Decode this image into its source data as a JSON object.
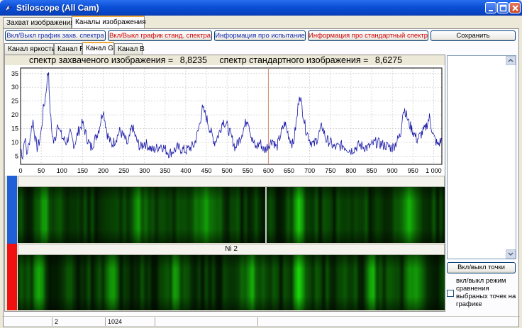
{
  "window": {
    "title": "Stiloscope (All Cam)"
  },
  "tabs": [
    "Захват изображения",
    "Каналы изображения"
  ],
  "toolbar": {
    "btn_captured": "Вкл/Выкл график захв. спектра",
    "btn_standard": "Вкл/Выкл график станд. спектра",
    "btn_test_info": "Информация про испытание",
    "btn_std_info": "Информация про стандартный спектр",
    "btn_save": "Сохранить"
  },
  "channel_tabs": [
    "Канал яркость",
    "Канал R",
    "Канал G",
    "Канал B"
  ],
  "chart_header": {
    "captured_label": "спектр захваченого изображения =",
    "captured_value": "8,8235",
    "standard_label": "спектр стандартного изображения =",
    "standard_value": "8,6275"
  },
  "chart_data": {
    "type": "line",
    "title": "",
    "xlabel": "",
    "ylabel": "",
    "xlim": [
      0,
      1020
    ],
    "ylim": [
      2,
      37
    ],
    "x_ticks": [
      0,
      50,
      100,
      150,
      200,
      250,
      300,
      350,
      400,
      450,
      500,
      550,
      600,
      650,
      700,
      750,
      800,
      850,
      900,
      950,
      1000
    ],
    "x_tick_labels": [
      "0",
      "50",
      "100",
      "150",
      "200",
      "250",
      "300",
      "350",
      "400",
      "450",
      "500",
      "550",
      "600",
      "650",
      "700",
      "750",
      "800",
      "850",
      "900",
      "950",
      "1 000"
    ],
    "y_ticks": [
      5,
      10,
      15,
      20,
      25,
      30,
      35
    ],
    "grid": true,
    "marker_x": 600,
    "colors": {
      "line": "#1a1aa8",
      "marker": "#d08a6a"
    },
    "series": [
      {
        "x": [
          0,
          5,
          10,
          15,
          20,
          25,
          30,
          35,
          40,
          45,
          50,
          55,
          60,
          65,
          68,
          70,
          75,
          80,
          85,
          90,
          95,
          100,
          110,
          120,
          130,
          140,
          150,
          160,
          170,
          180,
          190,
          200,
          210,
          220,
          230,
          240,
          250,
          260,
          270,
          280,
          290,
          300,
          320,
          340,
          360,
          380,
          400,
          420,
          430,
          440,
          445,
          450,
          460,
          470,
          480,
          490,
          500,
          510,
          520,
          530,
          540,
          550,
          560,
          570,
          580,
          590,
          600,
          610,
          620,
          630,
          640,
          650,
          660,
          670,
          675,
          680,
          690,
          700,
          710,
          720,
          730,
          740,
          750,
          760,
          780,
          800,
          820,
          840,
          860,
          880,
          900,
          910,
          920,
          925,
          930,
          940,
          950,
          960,
          970,
          980,
          990,
          1000,
          1010,
          1020
        ],
        "y": [
          8,
          5,
          12,
          6,
          9,
          14,
          18,
          12,
          8,
          10,
          14,
          22,
          26,
          34,
          36,
          25,
          15,
          10,
          12,
          18,
          14,
          12,
          10,
          13,
          9,
          14,
          17,
          12,
          8,
          11,
          15,
          22,
          13,
          9,
          11,
          14,
          12,
          9,
          16,
          11,
          8,
          10,
          7,
          9,
          6,
          8,
          7,
          9,
          14,
          22,
          21,
          19,
          14,
          10,
          13,
          18,
          16,
          12,
          8,
          11,
          15,
          19,
          11,
          8,
          10,
          7,
          9,
          11,
          8,
          13,
          17,
          12,
          9,
          20,
          28,
          24,
          15,
          11,
          9,
          12,
          16,
          11,
          10,
          8,
          9,
          7,
          9,
          8,
          10,
          9,
          8,
          10,
          13,
          21,
          22,
          17,
          14,
          11,
          13,
          15,
          19,
          12,
          9,
          11
        ]
      }
    ]
  },
  "spectrum_label": "Ni 2",
  "side": {
    "toggle_points": "Вкл/выкл точки",
    "compare_label": "вкл/выкл режим сравнения выбраных точек на графике"
  },
  "status": {
    "cell2": "2",
    "cell3": "1024"
  }
}
